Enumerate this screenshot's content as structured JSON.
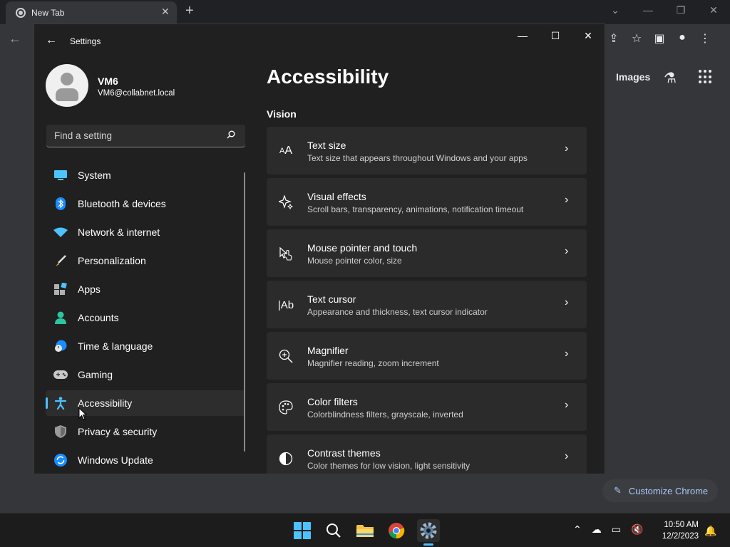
{
  "browser": {
    "tab_title": "New Tab",
    "images_link": "Images",
    "customize_label": "Customize Chrome"
  },
  "settings": {
    "app_title": "Settings",
    "user": {
      "name": "VM6",
      "email": "VM6@collabnet.local"
    },
    "search_placeholder": "Find a setting",
    "nav": [
      {
        "label": "System",
        "icon": "monitor-icon"
      },
      {
        "label": "Bluetooth & devices",
        "icon": "bluetooth-icon"
      },
      {
        "label": "Network & internet",
        "icon": "wifi-icon"
      },
      {
        "label": "Personalization",
        "icon": "brush-icon"
      },
      {
        "label": "Apps",
        "icon": "apps-icon"
      },
      {
        "label": "Accounts",
        "icon": "person-icon"
      },
      {
        "label": "Time & language",
        "icon": "clock-globe-icon"
      },
      {
        "label": "Gaming",
        "icon": "controller-icon"
      },
      {
        "label": "Accessibility",
        "icon": "accessibility-icon",
        "active": true
      },
      {
        "label": "Privacy & security",
        "icon": "shield-icon"
      },
      {
        "label": "Windows Update",
        "icon": "update-icon"
      }
    ],
    "page_title": "Accessibility",
    "section_title": "Vision",
    "cards": [
      {
        "title": "Text size",
        "desc": "Text size that appears throughout Windows and your apps",
        "icon": "text-size-icon"
      },
      {
        "title": "Visual effects",
        "desc": "Scroll bars, transparency, animations, notification timeout",
        "icon": "sparkle-icon"
      },
      {
        "title": "Mouse pointer and touch",
        "desc": "Mouse pointer color, size",
        "icon": "pointer-touch-icon"
      },
      {
        "title": "Text cursor",
        "desc": "Appearance and thickness, text cursor indicator",
        "icon": "text-cursor-icon"
      },
      {
        "title": "Magnifier",
        "desc": "Magnifier reading, zoom increment",
        "icon": "magnifier-icon"
      },
      {
        "title": "Color filters",
        "desc": "Colorblindness filters, grayscale, inverted",
        "icon": "palette-icon"
      },
      {
        "title": "Contrast themes",
        "desc": "Color themes for low vision, light sensitivity",
        "icon": "contrast-icon"
      }
    ]
  },
  "taskbar": {
    "time": "10:50 AM",
    "date": "12/2/2023"
  },
  "colors": {
    "accent": "#4cc2ff",
    "card": "#2b2b2b",
    "window": "#202020"
  }
}
